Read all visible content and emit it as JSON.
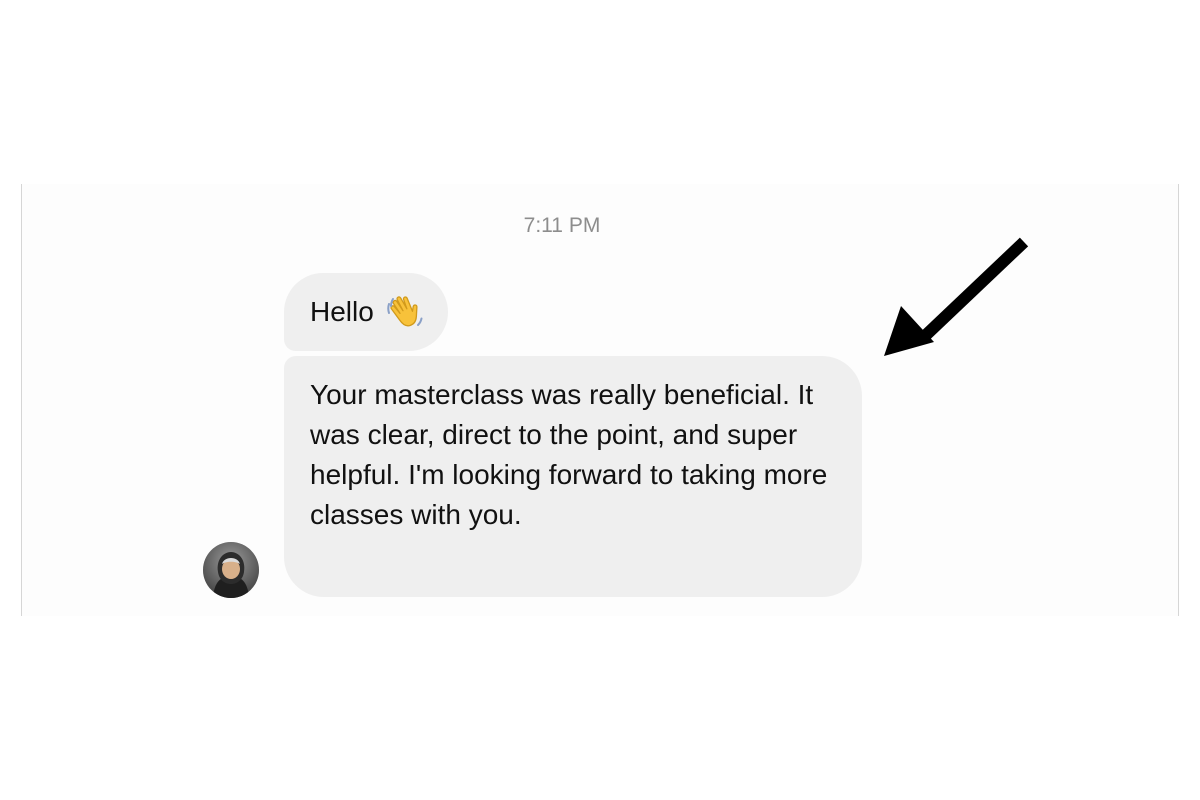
{
  "conversation": {
    "timestamp": "7:11 PM",
    "messages": [
      {
        "text": "Hello",
        "emoji": "waving-hand"
      },
      {
        "text": "Your masterclass was really beneficial. It was clear, direct to the point, and super helpful. I'm looking forward to taking more classes with you."
      }
    ]
  },
  "annotation": {
    "icon": "arrow-icon",
    "color": "#000000"
  },
  "colors": {
    "bubble": "#efefef",
    "timestamp": "#8d8d8d",
    "text": "#111111"
  }
}
